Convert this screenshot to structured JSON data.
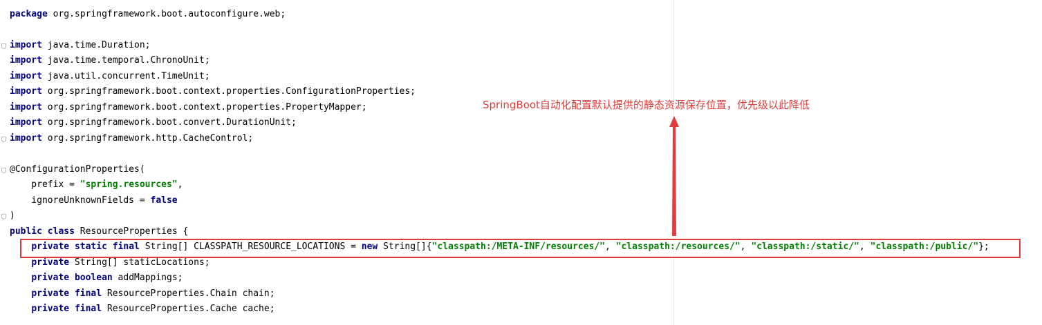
{
  "annotation": {
    "text": "SpringBoot自动化配置默认提供的静态资源保存位置，优先级以此降低",
    "color": "#e03c3c"
  },
  "colors": {
    "keyword": "#000080",
    "string": "#008000",
    "highlight_box": "#e03c3c"
  },
  "code": {
    "package_kw": "package",
    "package_name": " org.springframework.boot.autoconfigure.web;",
    "import_kw": "import",
    "imports": [
      " java.time.Duration;",
      " java.time.temporal.ChronoUnit;",
      " java.util.concurrent.TimeUnit;",
      " org.springframework.boot.context.properties.ConfigurationProperties;",
      " org.springframework.boot.context.properties.PropertyMapper;",
      " org.springframework.boot.convert.DurationUnit;",
      " org.springframework.http.CacheControl;"
    ],
    "annotation_open": "@ConfigurationProperties(",
    "prefix_key": "    prefix = ",
    "prefix_value": "\"spring.resources\"",
    "comma": ",",
    "ignore_key": "    ignoreUnknownFields = ",
    "ignore_value": "false",
    "annotation_close": ")",
    "class_decl": {
      "public": "public",
      "class": "class",
      "name": " ResourceProperties {"
    },
    "locations_line": {
      "indent": "    ",
      "private": "private",
      "static": "static",
      "final": "final",
      "decl": " String[] CLASSPATH_RESOURCE_LOCATIONS = ",
      "new": "new",
      "array": " String[]{",
      "values": [
        "\"classpath:/META-INF/resources/\"",
        "\"classpath:/resources/\"",
        "\"classpath:/static/\"",
        "\"classpath:/public/\""
      ],
      "sep": ", ",
      "end": "};"
    },
    "fields": {
      "indent": "    ",
      "private": "private",
      "boolean": "boolean",
      "final": "final",
      "static_locations": " String[] staticLocations;",
      "add_mappings": " addMappings;",
      "chain": " ResourceProperties.Chain chain;",
      "cache": " ResourceProperties.Cache cache;"
    }
  }
}
